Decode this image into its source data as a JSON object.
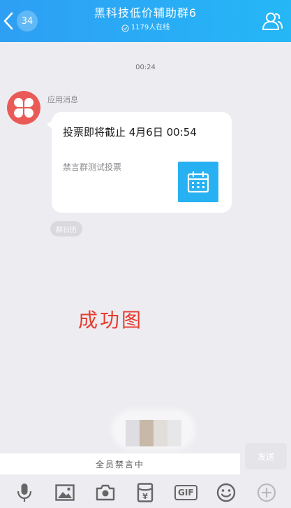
{
  "header": {
    "back_count": "34",
    "title": "黑科技低价辅助群6",
    "online": "1179人在线"
  },
  "timestamp": "00:24",
  "message": {
    "sender": "应用消息",
    "title": "投票即将截止 4月6日 00:54",
    "description": "禁言群测试投票",
    "source_tag": "群日历"
  },
  "overlay_text": "成功图",
  "input": {
    "muted_text": "全员禁言中",
    "send_label": "发送"
  },
  "toolbar": {
    "gif_label": "GIF"
  },
  "colors": {
    "header": "#2ea2f4",
    "accent": "#27b1f2",
    "overlay_red": "#e63b2f",
    "avatar": "#ea5b58"
  }
}
